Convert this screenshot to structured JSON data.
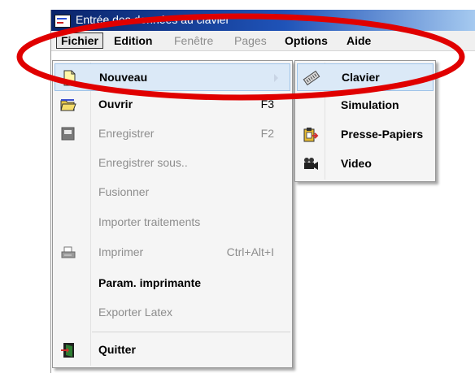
{
  "window": {
    "title": "Entrée des données au clavier"
  },
  "menubar": {
    "items": [
      {
        "label": "Fichier",
        "state": "open"
      },
      {
        "label": "Edition",
        "state": "enabled"
      },
      {
        "label": "Fenêtre",
        "state": "disabled"
      },
      {
        "label": "Pages",
        "state": "disabled"
      },
      {
        "label": "Options",
        "state": "enabled"
      },
      {
        "label": "Aide",
        "state": "enabled"
      }
    ]
  },
  "fichier_menu": {
    "items": [
      {
        "label": "Nouveau",
        "shortcut": "",
        "icon": "new-document-icon",
        "highlighted": true,
        "has_submenu": true
      },
      {
        "label": "Ouvrir",
        "shortcut": "F3",
        "icon": "open-folder-icon"
      },
      {
        "label": "Enregistrer",
        "shortcut": "F2",
        "icon": "save-icon"
      },
      {
        "label": "Enregistrer sous..",
        "shortcut": ""
      },
      {
        "label": "Fusionner",
        "shortcut": ""
      },
      {
        "label": "Importer traitements",
        "shortcut": ""
      },
      {
        "label": "Imprimer",
        "shortcut": "Ctrl+Alt+I",
        "icon": "printer-icon"
      },
      {
        "label": "Param. imprimante",
        "shortcut": ""
      },
      {
        "label": "Exporter Latex",
        "shortcut": ""
      },
      {
        "label": "Quitter",
        "shortcut": "",
        "icon": "exit-door-icon"
      }
    ]
  },
  "nouveau_submenu": {
    "items": [
      {
        "label": "Clavier",
        "icon": "keyboard-icon",
        "highlighted": true
      },
      {
        "label": "Simulation",
        "icon": ""
      },
      {
        "label": "Presse-Papiers",
        "icon": "clipboard-icon"
      },
      {
        "label": "Video",
        "icon": "video-camera-icon"
      }
    ]
  },
  "annotation": {
    "shape": "ellipse",
    "color": "#e00000"
  },
  "colors": {
    "highlight": "#dbe9f7",
    "disabled_text": "#8d8d8d",
    "menu_bg": "#f5f5f5"
  }
}
